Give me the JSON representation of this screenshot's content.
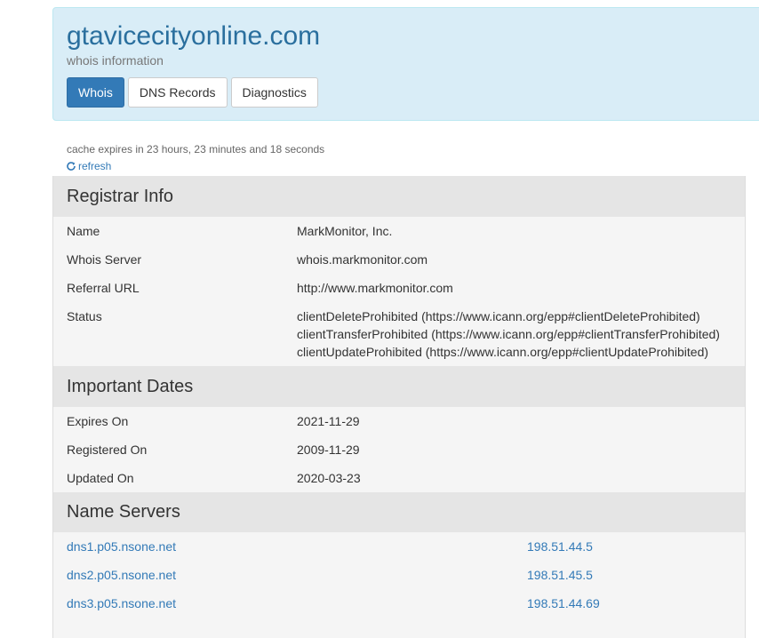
{
  "header": {
    "domain": "gtavicecityonline.com",
    "subtitle": "whois information",
    "tabs": [
      {
        "label": "Whois",
        "active": true
      },
      {
        "label": "DNS Records",
        "active": false
      },
      {
        "label": "Diagnostics",
        "active": false
      }
    ]
  },
  "cache": {
    "text": "cache expires in 23 hours, 23 minutes and 18 seconds",
    "refresh_label": "refresh",
    "refresh_icon": "refresh-icon"
  },
  "registrar": {
    "heading": "Registrar Info",
    "rows": [
      {
        "label": "Name",
        "value": "MarkMonitor, Inc."
      },
      {
        "label": "Whois Server",
        "value": "whois.markmonitor.com"
      },
      {
        "label": "Referral URL",
        "value": "http://www.markmonitor.com"
      }
    ],
    "status": {
      "label": "Status",
      "values": [
        "clientDeleteProhibited (https://www.icann.org/epp#clientDeleteProhibited)",
        "clientTransferProhibited (https://www.icann.org/epp#clientTransferProhibited)",
        "clientUpdateProhibited (https://www.icann.org/epp#clientUpdateProhibited)"
      ]
    }
  },
  "dates": {
    "heading": "Important Dates",
    "rows": [
      {
        "label": "Expires On",
        "value": "2021-11-29"
      },
      {
        "label": "Registered On",
        "value": "2009-11-29"
      },
      {
        "label": "Updated On",
        "value": "2020-03-23"
      }
    ]
  },
  "nameservers": {
    "heading": "Name Servers",
    "rows": [
      {
        "host": "dns1.p05.nsone.net",
        "ip": "198.51.44.5"
      },
      {
        "host": "dns2.p05.nsone.net",
        "ip": "198.51.45.5"
      },
      {
        "host": "dns3.p05.nsone.net",
        "ip": "198.51.44.69"
      }
    ]
  },
  "colors": {
    "accent": "#337ab7",
    "header_bg": "#d9edf7",
    "title": "#2a6f9e"
  }
}
